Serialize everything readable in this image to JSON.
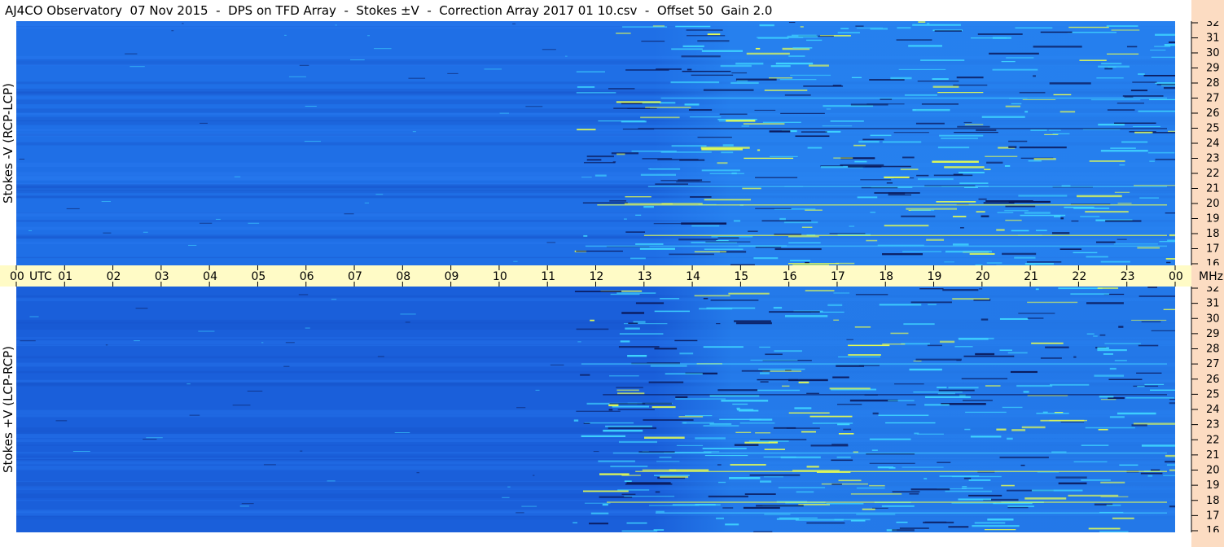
{
  "title": "AJ4CO Observatory  07 Nov 2015  -  DPS on TFD Array  -  Stokes ±V  -  Correction Array 2017 01 10.csv  -  Offset 50  Gain 2.0",
  "chart_data": [
    {
      "type": "heatmap",
      "name": "Stokes -V (RCP-LCP)",
      "ylabel": "Stokes -V (RCP-LCP)",
      "x_unit": "UTC",
      "y_unit": "MHz",
      "xlim": [
        0,
        24
      ],
      "ylim": [
        16,
        32
      ],
      "x_ticks": [
        "00",
        "01",
        "02",
        "03",
        "04",
        "05",
        "06",
        "07",
        "08",
        "09",
        "10",
        "11",
        "12",
        "13",
        "14",
        "15",
        "16",
        "17",
        "18",
        "19",
        "20",
        "21",
        "22",
        "23",
        "00"
      ],
      "y_ticks": [
        "32",
        "31",
        "30",
        "29",
        "28",
        "27",
        "26",
        "25",
        "24",
        "23",
        "22",
        "21",
        "20",
        "19",
        "18",
        "17",
        "16"
      ],
      "colors": {
        "background": "#1f6fe6",
        "intense": "#3fd6ff",
        "high": "#e8ff50",
        "low": "#0a1a5c"
      }
    },
    {
      "type": "heatmap",
      "name": "Stokes +V (LCP-RCP)",
      "ylabel": "Stokes +V (LCP-RCP)",
      "x_unit": "UTC",
      "y_unit": "MHz",
      "xlim": [
        0,
        24
      ],
      "ylim": [
        16,
        32
      ],
      "x_ticks": [
        "00",
        "01",
        "02",
        "03",
        "04",
        "05",
        "06",
        "07",
        "08",
        "09",
        "10",
        "11",
        "12",
        "13",
        "14",
        "15",
        "16",
        "17",
        "18",
        "19",
        "20",
        "21",
        "22",
        "23",
        "00"
      ],
      "y_ticks": [
        "32",
        "31",
        "30",
        "29",
        "28",
        "27",
        "26",
        "25",
        "24",
        "23",
        "22",
        "21",
        "20",
        "19",
        "18",
        "17",
        "16"
      ],
      "colors": {
        "background": "#1a5fda",
        "intense": "#3fd6ff",
        "high": "#e8ff50",
        "low": "#0a1a5c"
      }
    }
  ],
  "axis": {
    "utc_label": "UTC",
    "mhz_label": "MHz"
  }
}
